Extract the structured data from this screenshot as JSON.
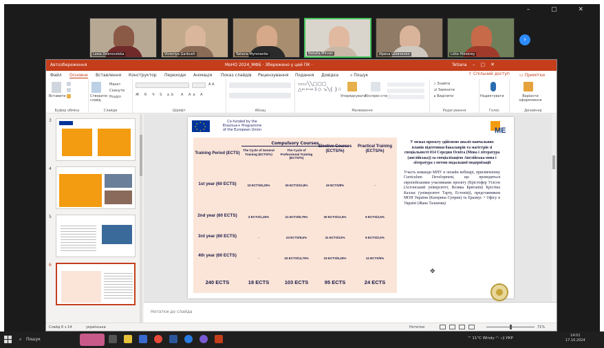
{
  "meeting": {
    "title": "МоНО 2024_МФБ · Збережено у цей ПК ·",
    "participants": [
      {
        "name": "Lesia Dobrovolska"
      },
      {
        "name": "Victoriya Garbush"
      },
      {
        "name": "Tatiana Myronenko"
      },
      {
        "name": "Natalia Mirvan"
      },
      {
        "name": "Ирина Шевченко"
      },
      {
        "name": "Lidia Hibsbrey"
      }
    ]
  },
  "ppt": {
    "autosave": "Автозбереження",
    "doc_title": "МоНО 2024_МФБ · Збережено у цей ПК ·",
    "account": "Tetiana",
    "tabs": [
      "Файл",
      "Основне",
      "Вставлення",
      "Конструктор",
      "Переходи",
      "Анімація",
      "Показ слайдів",
      "Рецензування",
      "Подання",
      "Довідка",
      "Пошук"
    ],
    "share": "Спільний доступ",
    "notes_btn": "Примітки",
    "ribbon_groups": [
      "Буфер обміну",
      "Слайди",
      "Шрифт",
      "Абзац",
      "Малювання",
      "Редагування",
      "Голос",
      "Дизайнер"
    ],
    "ribbon_buttons": {
      "paste": "Вставити",
      "new_slide": "Створити слайд",
      "layout": "Макет",
      "reset": "Скинути",
      "section": "Розділ",
      "arrange": "Упорядкувати",
      "styles": "Експрес-стилі",
      "find": "Знайти",
      "replace": "Замінити",
      "select": "Виділити",
      "dictate": "Надиктувати",
      "designer": "Варіанти оформлення"
    },
    "thumb_numbers": [
      "3",
      "4",
      "5",
      "6"
    ],
    "notes_placeholder": "Нотатки до слайда",
    "status": {
      "slide": "Слайд 6 з 14",
      "lang": "українська",
      "notes": "Нотатки",
      "zoom": "71%"
    }
  },
  "slide": {
    "eu_text": [
      "Co-funded by the",
      "Erasmus+ Programme",
      "of the European Union"
    ],
    "logo": "ME",
    "table": {
      "group_header": "Compulsory Courses",
      "headers": [
        "Training Period (ECTS)",
        "The Cycle of General Training (ECTS/%)",
        "The Cycle of Professional Training (ECTS/%)",
        "Elective Courses (ECTS/%)",
        "Practical Training (ECTS/%)"
      ],
      "rows": [
        {
          "period": "1st year (60 ECTS)",
          "general": "15 ECTS/6,25%",
          "professional": "26 ECTS/10,8%",
          "elective": "19 ECTS/8%",
          "practical": "-"
        },
        {
          "period": "2nd year (60 ECTS)",
          "general": "3 ECTS/1,25%",
          "professional": "21 ECTS/8,75%",
          "elective": "30 ECTS/12,5%",
          "practical": "6 ECTS/2,5%"
        },
        {
          "period": "3rd year (60 ECTS)",
          "general": "-",
          "professional": "23 ECTS/9,6%",
          "elective": "31 ECTS/13%",
          "practical": "6 ECTS/2,5%"
        },
        {
          "period": "4th year (60 ECTS)",
          "general": "-",
          "professional": "33 ECTS/13,75%",
          "elective": "15 ECTS/6,25%",
          "practical": "12 ECTS/5%"
        }
      ],
      "totals": {
        "period": "240 ECTS",
        "general": "18 ECTS",
        "professional": "103 ECTS",
        "elective": "95 ECTS",
        "practical": "24 ECTS"
      }
    },
    "right_title": "У межах проєкту здійснено аналіз навчальних планів підготовки бакалаврів та магістрів зі спеціальності 014 Середня Освіта (Мова і література (англійська)) за спеціалізацією Англійська мова і література з метою подальшої модернізації",
    "right_body": "Участь команди МНУ в онлайн вебінарі, присвяченому Curriculum Development, що проводиться європейськими учасниками проєкту (Крістофер Уілсон (Астонський університет, Велика Британія) Крістіна Каллас (університет Тарту, Естонія)), представником МОН України (Катерина Суприн) та Еразмус + Офісу в Україні (Жана Таланова)"
  },
  "taskbar": {
    "search": "Пошук",
    "weather": "11°C Windy",
    "lang": "УКР",
    "time": "14:01",
    "date": "17.10.2024"
  },
  "colors": {
    "ppt_accent": "#c43e1c",
    "table_bg": "#fbe5d8",
    "active_speaker": "#43c35c"
  }
}
